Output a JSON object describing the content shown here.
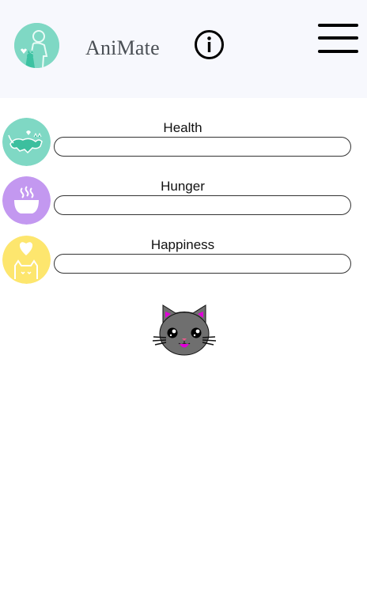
{
  "header": {
    "app_title": "AniMate",
    "logo_icon": "pet-owner-logo-icon",
    "info_icon": "info-icon",
    "menu_icon": "hamburger-menu-icon"
  },
  "stats": [
    {
      "label": "Health",
      "icon": "cat-health-icon",
      "color": "#7fd8c4",
      "level": 0
    },
    {
      "label": "Hunger",
      "icon": "food-bowl-icon",
      "color": "#c398f0",
      "level": 0
    },
    {
      "label": "Happiness",
      "icon": "heart-cat-icon",
      "color": "#fde66e",
      "level": 0
    }
  ],
  "pet": {
    "icon": "gray-cat-face-icon",
    "fur_color": "#6f6f6f",
    "accent_color": "#e000d8"
  }
}
